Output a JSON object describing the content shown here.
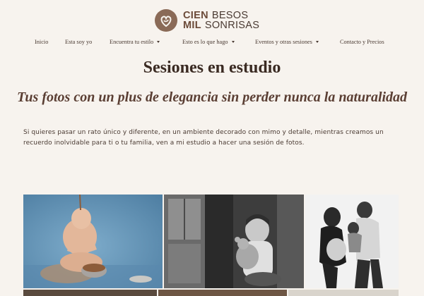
{
  "header": {
    "logo": {
      "line1_bold": "CIEN",
      "line1_light": "BESOS",
      "line2_bold": "MIL",
      "line2_light": "SONRISAS",
      "icon": "heart-monogram-icon"
    },
    "nav": [
      {
        "label": "Inicio",
        "dropdown": false
      },
      {
        "label": "Esta soy yo",
        "dropdown": false
      },
      {
        "label": "Encuentra tu estilo",
        "dropdown": true
      },
      {
        "label": "Esto es lo que hago",
        "dropdown": true
      },
      {
        "label": "Eventos y otras sesiones",
        "dropdown": true
      },
      {
        "label": "Contacto y Precios",
        "dropdown": false
      }
    ]
  },
  "main": {
    "title": "Sesiones en estudio",
    "subtitle": "Tus fotos con un plus de elegancia sin perder nunca la naturalidad",
    "intro": "Si quieres pasar un rato único y diferente, en un ambiente decorado con mimo y detalle, mientras creamos un recuerdo inolvidable para ti o tu familia, ven a mi estudio a hacer una sesión de fotos."
  },
  "colors": {
    "background": "#f7f3ee",
    "brand": "#8a6a57",
    "text": "#3a2a22"
  }
}
